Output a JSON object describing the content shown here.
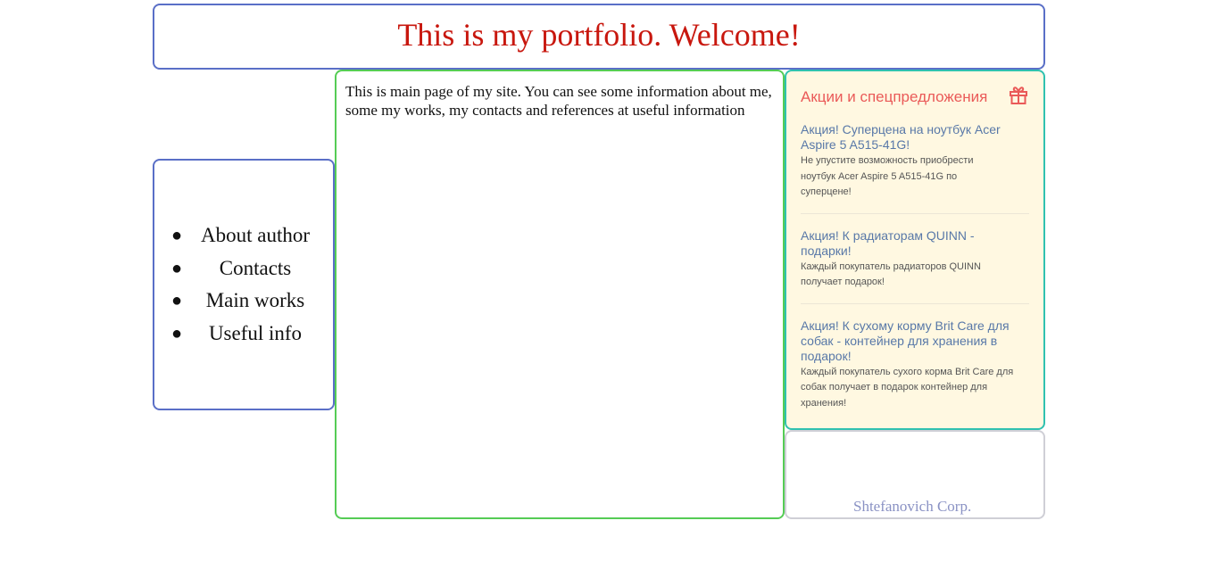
{
  "header": {
    "title": "This is my portfolio. Welcome!"
  },
  "nav": {
    "items": [
      {
        "label": "About author"
      },
      {
        "label": "Contacts"
      },
      {
        "label": "Main works"
      },
      {
        "label": "Useful info"
      }
    ]
  },
  "main": {
    "text": "This is main page of my site. You can see some information about me, some my works, my contacts and references at useful information"
  },
  "promo": {
    "title": "Акции и спецпредложения",
    "icon": "gift-icon",
    "items": [
      {
        "link": "Акция! Суперцена на ноутбук Acer Aspire 5 A515-41G!",
        "desc": "Не упустите возможность приобрести ноутбук Acer Aspire 5 A515-41G по суперцене!"
      },
      {
        "link": "Акция! К радиаторам QUINN - подарки!",
        "desc": "Каждый покупатель радиаторов QUINN получает подарок!"
      },
      {
        "link": "Акция! К сухому корму Brit Care для собак - контейнер для хранения в подарок!",
        "desc": "Каждый покупатель сухого корма Brit Care для собак получает в подарок контейнер для хранения!"
      }
    ]
  },
  "footer": {
    "text": "Shtefanovich Corp."
  },
  "colors": {
    "header_border": "#5a6fc7",
    "title": "#c8170e",
    "main_border": "#55cc55",
    "promo_border": "#2fc1b0",
    "promo_bg": "#fff8e1",
    "promo_title": "#ea5a58",
    "promo_link": "#5878a8",
    "footer_text": "#8a92c4"
  }
}
